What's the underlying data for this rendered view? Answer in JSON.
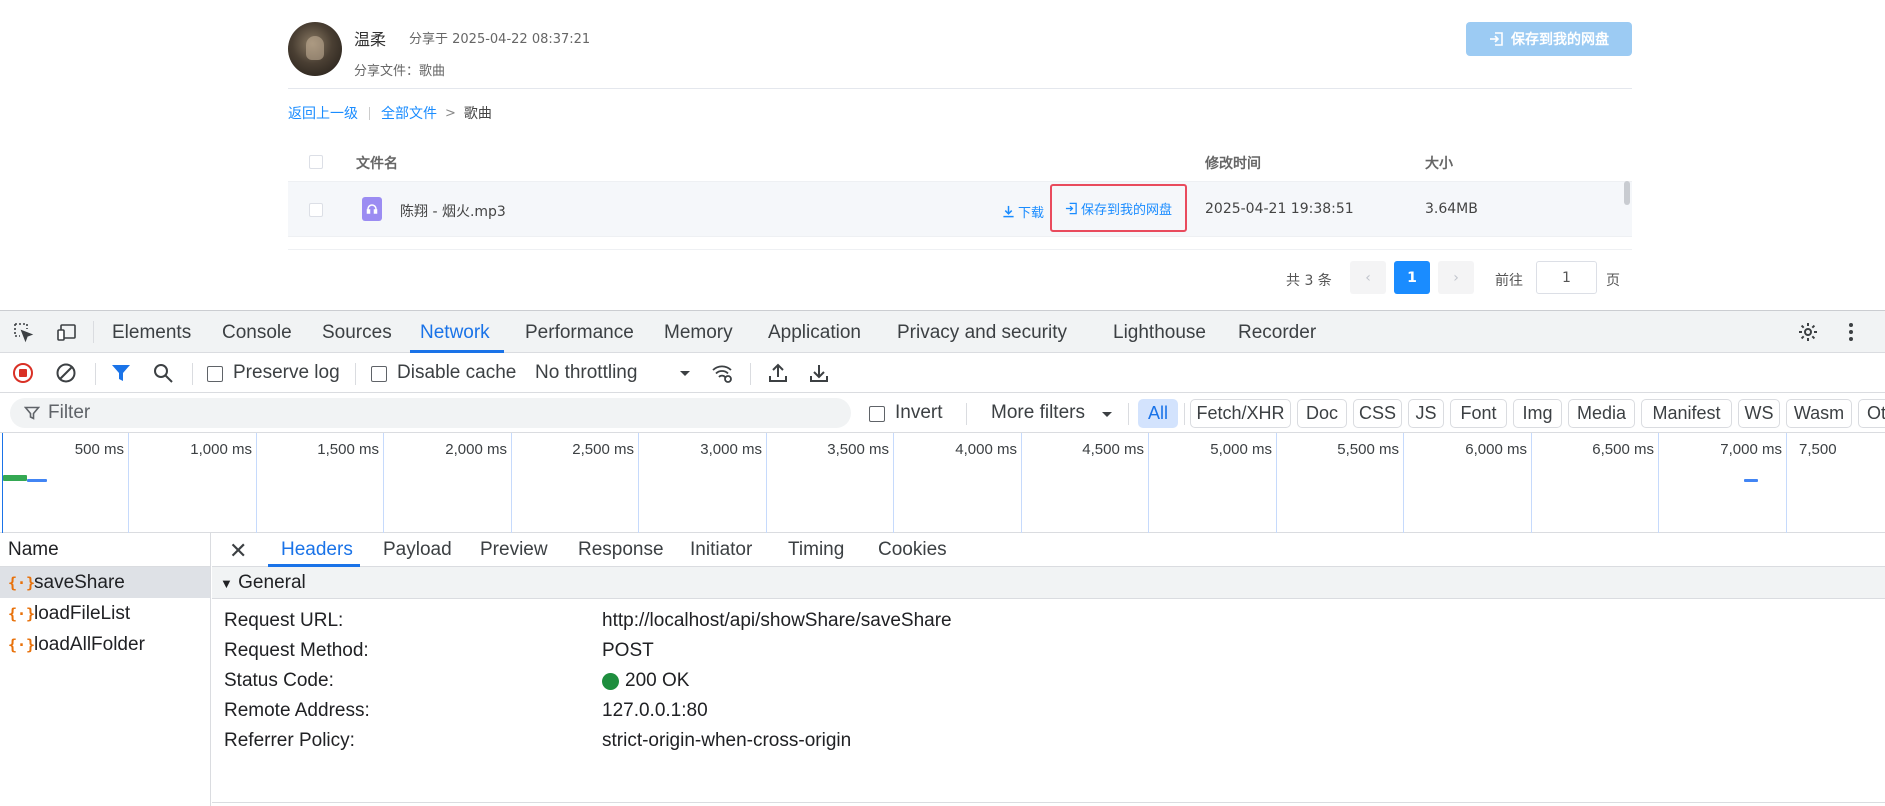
{
  "share": {
    "user_name": "温柔",
    "share_time": "分享于 2025-04-22 08:37:21",
    "share_file": "分享文件：歌曲",
    "save_button": "保存到我的网盘",
    "breadcrumb": {
      "back": "返回上一级",
      "all_files": "全部文件",
      "arrow": ">",
      "current": "歌曲"
    },
    "table": {
      "headers": {
        "name": "文件名",
        "modified": "修改时间",
        "size": "大小"
      },
      "rows": [
        {
          "name": "陈翔 - 烟火.mp3",
          "download": "下载",
          "save": "保存到我的网盘",
          "modified": "2025-04-21 19:38:51",
          "size": "3.64MB"
        }
      ]
    },
    "pagination": {
      "total": "共 3 条",
      "prev": "‹",
      "current_page": "1",
      "next": "›",
      "goto_label": "前往",
      "goto_value": "1",
      "goto_unit": "页"
    }
  },
  "devtools": {
    "tabs": [
      "Elements",
      "Console",
      "Sources",
      "Network",
      "Performance",
      "Memory",
      "Application",
      "Privacy and security",
      "Lighthouse",
      "Recorder"
    ],
    "active_tab": "Network",
    "toolbar": {
      "preserve_log": "Preserve log",
      "disable_cache": "Disable cache",
      "throttling": "No throttling"
    },
    "filter": {
      "placeholder": "Filter",
      "invert": "Invert",
      "more_filters": "More filters",
      "types": [
        "All",
        "Fetch/XHR",
        "Doc",
        "CSS",
        "JS",
        "Font",
        "Img",
        "Media",
        "Manifest",
        "WS",
        "Wasm",
        "Oth"
      ],
      "active_type": "All"
    },
    "timeline": {
      "ticks": [
        "500 ms",
        "1,000 ms",
        "1,500 ms",
        "2,000 ms",
        "2,500 ms",
        "3,000 ms",
        "3,500 ms",
        "4,000 ms",
        "4,500 ms",
        "5,000 ms",
        "5,500 ms",
        "6,000 ms",
        "6,500 ms",
        "7,000 ms",
        "7,500"
      ]
    },
    "requests": {
      "header": "Name",
      "items": [
        "saveShare",
        "loadFileList",
        "loadAllFolder"
      ],
      "selected": "saveShare"
    },
    "detail": {
      "tabs": [
        "Headers",
        "Payload",
        "Preview",
        "Response",
        "Initiator",
        "Timing",
        "Cookies"
      ],
      "active_tab": "Headers",
      "section": "General",
      "general": [
        {
          "key": "Request URL:",
          "value": "http://localhost/api/showShare/saveShare"
        },
        {
          "key": "Request Method:",
          "value": "POST"
        },
        {
          "key": "Status Code:",
          "value": "200 OK"
        },
        {
          "key": "Remote Address:",
          "value": "127.0.0.1:80"
        },
        {
          "key": "Referrer Policy:",
          "value": "strict-origin-when-cross-origin"
        }
      ]
    },
    "colors": {
      "accent": "#1a73e8",
      "status_ok": "#1e8e3e",
      "record": "#d93025",
      "highlight_border": "#e94b5d"
    }
  }
}
